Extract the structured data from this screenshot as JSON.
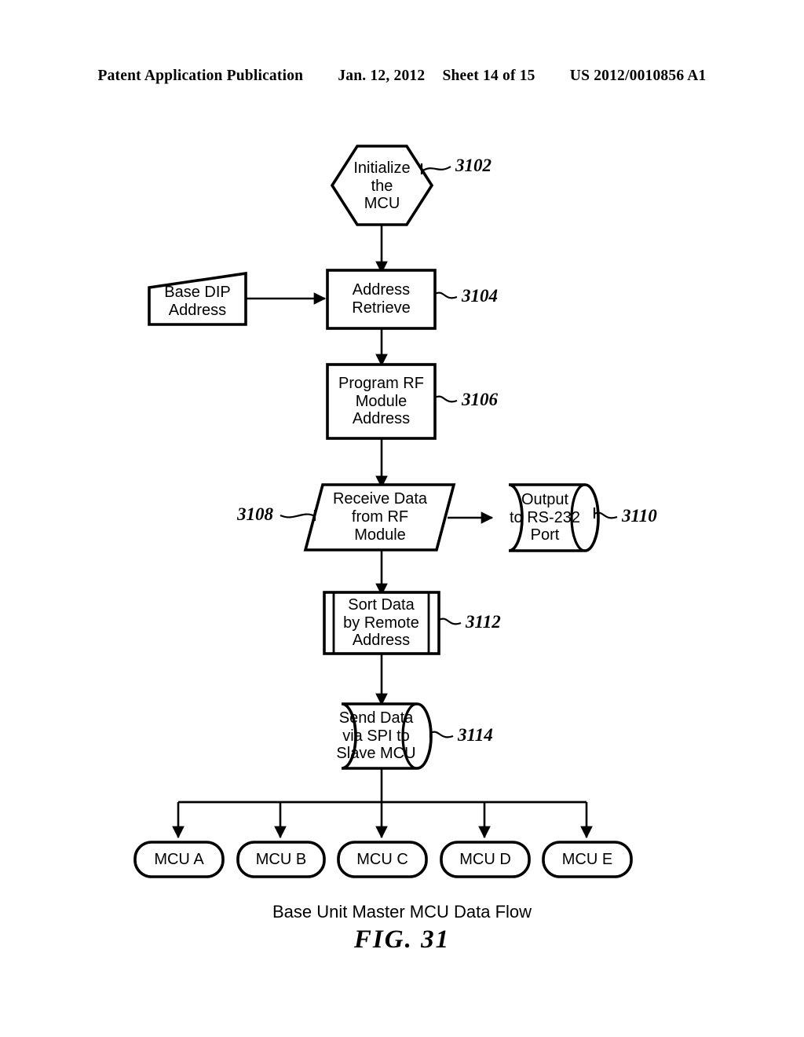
{
  "header": {
    "publication": "Patent Application Publication",
    "date": "Jan. 12, 2012",
    "sheet": "Sheet 14 of 15",
    "patent_number": "US 2012/0010856 A1"
  },
  "caption": {
    "title": "Base Unit Master MCU Data Flow",
    "figure": "FIG.  31"
  },
  "diagram": {
    "nodes": {
      "initialize": {
        "label": "Initialize\nthe\nMCU",
        "ref": "3102",
        "shape": "hexagon"
      },
      "base_dip": {
        "label": "Base DIP\nAddress",
        "ref": "",
        "shape": "manual-input"
      },
      "address_retrieve": {
        "label": "Address\nRetrieve",
        "ref": "3104",
        "shape": "process"
      },
      "program_rf": {
        "label": "Program RF\nModule\nAddress",
        "ref": "3106",
        "shape": "process"
      },
      "receive_data": {
        "label": "Receive Data\nfrom RF\nModule",
        "ref": "3108",
        "shape": "parallelogram"
      },
      "output_rs232": {
        "label": "Output\nto RS-232\nPort",
        "ref": "3110",
        "shape": "cylinder"
      },
      "sort_data": {
        "label": "Sort Data\nby Remote\nAddress",
        "ref": "3112",
        "shape": "predefined-process"
      },
      "send_data": {
        "label": "Send Data\nvia SPI to\nSlave MCU",
        "ref": "3114",
        "shape": "cylinder"
      }
    },
    "mcu_terminals": [
      {
        "label": "MCU A"
      },
      {
        "label": "MCU B"
      },
      {
        "label": "MCU C"
      },
      {
        "label": "MCU D"
      },
      {
        "label": "MCU E"
      }
    ]
  },
  "colors": {
    "ink": "#000000",
    "paper": "#ffffff"
  }
}
